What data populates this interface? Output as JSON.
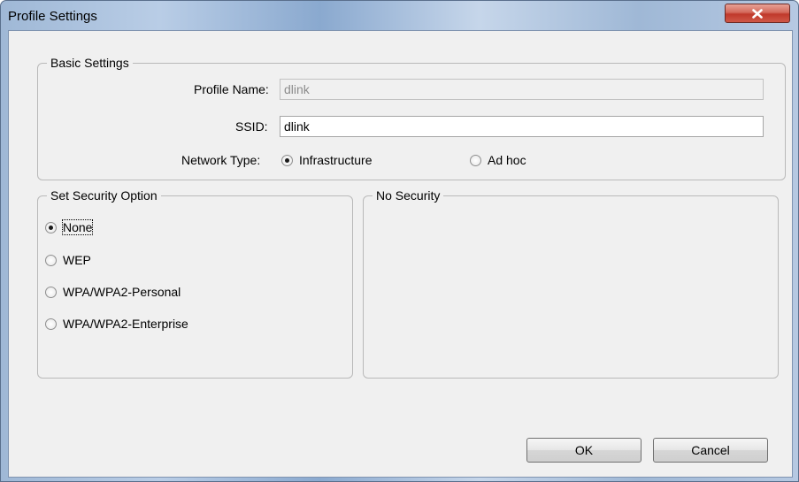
{
  "window": {
    "title": "Profile Settings",
    "close_icon": "close-icon"
  },
  "basic_settings": {
    "legend": "Basic Settings",
    "profile_name_label": "Profile Name:",
    "profile_name_value": "dlink",
    "ssid_label": "SSID:",
    "ssid_value": "dlink",
    "network_type_label": "Network Type:",
    "network_type_options": [
      {
        "label": "Infrastructure",
        "checked": true
      },
      {
        "label": "Ad hoc",
        "checked": false
      }
    ]
  },
  "security": {
    "legend": "Set Security Option",
    "options": [
      {
        "label": "None",
        "checked": true
      },
      {
        "label": "WEP",
        "checked": false
      },
      {
        "label": "WPA/WPA2-Personal",
        "checked": false
      },
      {
        "label": "WPA/WPA2-Enterprise",
        "checked": false
      }
    ]
  },
  "security_detail": {
    "legend": "No Security"
  },
  "buttons": {
    "ok": "OK",
    "cancel": "Cancel"
  },
  "colors": {
    "close_button": "#c0392b",
    "dialog_bg": "#f0f0f0",
    "title_glass": "#9fb8d6"
  }
}
